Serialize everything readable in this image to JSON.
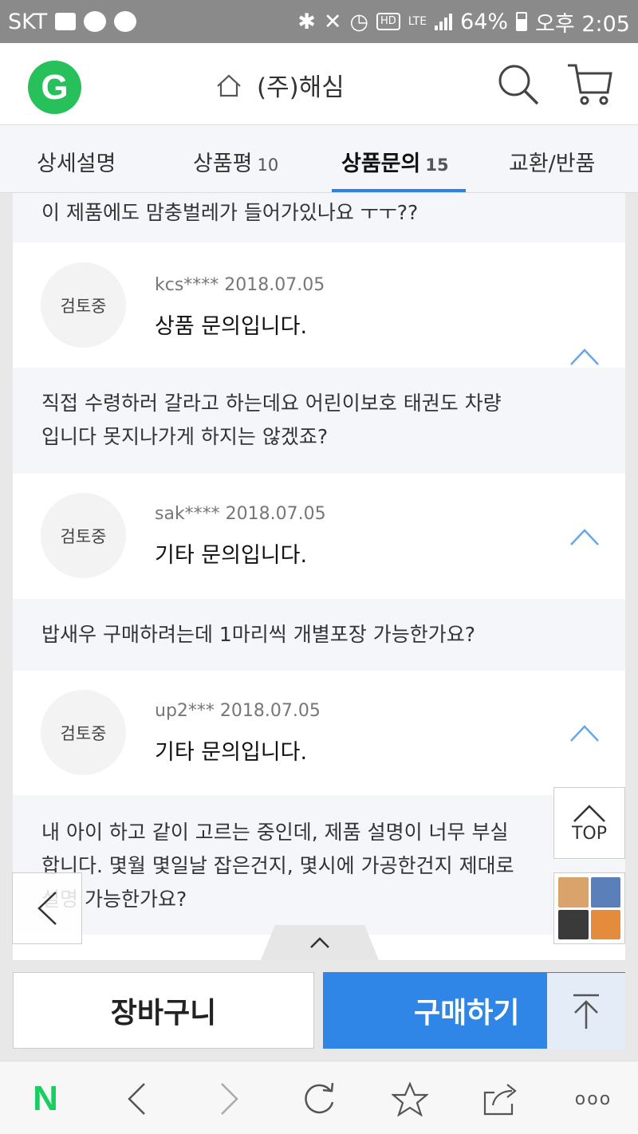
{
  "status": {
    "carrier": "SKT",
    "talk_icon_label": "TALK",
    "hd_label": "HD",
    "lte_label": "LTE",
    "battery": "64%",
    "time": "오후 2:05"
  },
  "header": {
    "title": "(주)해심",
    "logo_letter": "G"
  },
  "tabs": [
    {
      "label": "상세설명",
      "count": ""
    },
    {
      "label": "상품평",
      "count": "10"
    },
    {
      "label": "상품문의",
      "count": "15"
    },
    {
      "label": "교환/반품",
      "count": ""
    }
  ],
  "qna": {
    "top_partial_text": "이 제품에도 맘충벌레가 들어가있나요 ㅜㅜ??",
    "items": [
      {
        "badge": "검토중",
        "meta": "kcs**** 2018.07.05",
        "title": "상품 문의입니다.",
        "text_line1": "직접 수령하러 갈라고 하는데요 어린이보호 태권도 차량",
        "text_line2": "입니다 못지나가게 하지는 않겠죠?"
      },
      {
        "badge": "검토중",
        "meta": "sak**** 2018.07.05",
        "title": "기타 문의입니다.",
        "text_line1": "밥새우 구매하려는데 1마리씩 개별포장 가능한가요?",
        "text_line2": ""
      },
      {
        "badge": "검토중",
        "meta": "up2*** 2018.07.05",
        "title": "기타 문의입니다.",
        "text_line1": "내 아이 하고 같이 고르는 중인데, 제품 설명이 너무 부실",
        "text_line2": "합니다. 몇월 몇일날 잡은건지, 몇시에 가공한건지 제대로",
        "text_line3": "설명 가능한가요?"
      }
    ]
  },
  "floating": {
    "top_label": "TOP"
  },
  "buybar": {
    "cart_label": "장바구니",
    "buy_label": "구매하기"
  },
  "colors": {
    "accent": "#2f86e6",
    "logo": "#27c05a",
    "naver": "#19ce60"
  },
  "browser_nav": {
    "home_letter": "N",
    "more_label": "ooo"
  }
}
